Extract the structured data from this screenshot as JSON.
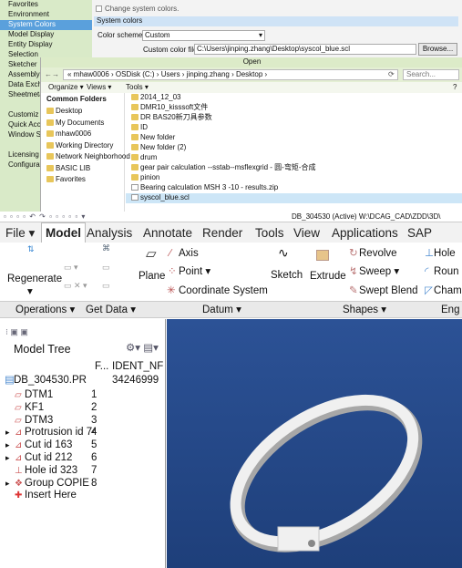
{
  "options_nav": {
    "items": [
      "Favorites",
      "Environment",
      "System Colors",
      "Model Display",
      "Entity Display",
      "Selection",
      "Sketcher",
      "Assembly",
      "Data Exch",
      "Sheetmeta",
      "",
      "Customiz",
      "Quick Acc",
      "Window Se",
      "",
      "Licensing",
      "Configurat"
    ],
    "selected_index": 2
  },
  "system_colors": {
    "checkbox_label": "Change system colors.",
    "section_title": "System colors",
    "scheme_label": "Color scheme:",
    "scheme_value": "Custom",
    "file_label": "Custom color file:",
    "file_value": "C:\\Users\\jinping.zhang\\Desktop\\syscol_blue.scl",
    "browse": "Browse..."
  },
  "open_dialog": {
    "title": "Open",
    "breadcrumb": "« mhaw0006 › OSDisk (C:) › Users › jinping.zhang › Desktop ›",
    "search": "Search...",
    "organize": "Organize ▾",
    "views": "Views ▾",
    "tools": "Tools ▾",
    "folders_header": "Common Folders",
    "folders": [
      "Desktop",
      "My Documents",
      "mhaw0006",
      "Working Directory",
      "Network Neighborhood",
      "BASIC LIB",
      "Favorites"
    ],
    "files": [
      "2014_12_03",
      "DMR10_kisssoft文件",
      "DR BAS20新刀具参数",
      "ID",
      "New folder",
      "New folder (2)",
      "drum",
      "gear pair calculation --sstab--msflexgrid - 圆-弯矩-合成",
      "pinion",
      "Bearing calculation MSH 3 -10 - results.zip",
      "syscol_blue.scl"
    ],
    "selected_file": 10
  },
  "title_bar": "DB_304530 (Active) W:\\DCAG_CAD\\ZDD\\3D\\",
  "menu_tabs": [
    "File ▾",
    "Model",
    "Analysis",
    "Annotate",
    "Render",
    "Tools",
    "View",
    "Applications",
    "SAP"
  ],
  "ribbon": {
    "regenerate": "Regenerate",
    "plane": "Plane",
    "axis": "Axis",
    "point": "Point ▾",
    "csys": "Coordinate System",
    "sketch": "Sketch",
    "extrude": "Extrude",
    "revolve": "Revolve",
    "sweep": "Sweep ▾",
    "swept_blend": "Swept Blend",
    "hole": "Hole",
    "round": "Roun",
    "chamfer": "Cham"
  },
  "groups": [
    "Operations ▾",
    "Get Data ▾",
    "Datum ▾",
    "Shapes ▾",
    "Eng"
  ],
  "model_tree": {
    "title": "Model Tree",
    "col_f": "F...",
    "col_id": "IDENT_NF",
    "root": "DB_304530.PR",
    "root_id": "34246999",
    "items": [
      {
        "label": "DTM1",
        "f": "1"
      },
      {
        "label": "KF1",
        "f": "2"
      },
      {
        "label": "DTM3",
        "f": "3"
      },
      {
        "label": "Protrusion id 74",
        "f": "4"
      },
      {
        "label": "Cut id 163",
        "f": "5"
      },
      {
        "label": "Cut id 212",
        "f": "6"
      },
      {
        "label": "Hole id 323",
        "f": "7"
      },
      {
        "label": "Group COPIE",
        "f": "8"
      },
      {
        "label": "Insert Here",
        "f": ""
      }
    ]
  },
  "colors": {
    "nav_bg": "#d9eac8",
    "selected": "#5aa0dc",
    "viewport": "#2a4d8c",
    "ring": "#efefef"
  }
}
